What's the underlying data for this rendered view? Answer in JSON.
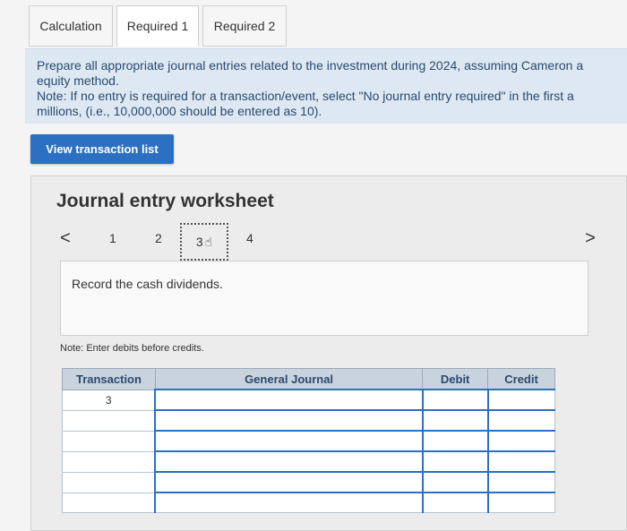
{
  "tabs": [
    {
      "label": "Calculation"
    },
    {
      "label": "Required 1"
    },
    {
      "label": "Required 2"
    }
  ],
  "instructions": {
    "line1": "Prepare all appropriate journal entries related to the investment during 2024, assuming Cameron a",
    "line2": "equity method.",
    "line3": "Note: If no entry is required for a transaction/event, select \"No journal entry required\" in the first a",
    "line4": "millions, (i.e., 10,000,000 should be entered as 10)."
  },
  "view_button": "View transaction list",
  "worksheet": {
    "title": "Journal entry worksheet",
    "nav_prev": "<",
    "nav_next": ">",
    "steps": [
      "1",
      "2",
      "3",
      "4"
    ],
    "prompt": "Record the cash dividends.",
    "note": "Note: Enter debits before credits."
  },
  "table": {
    "headers": {
      "transaction": "Transaction",
      "general_journal": "General Journal",
      "debit": "Debit",
      "credit": "Credit"
    },
    "rows": [
      {
        "transaction": "3",
        "account": "",
        "debit": "",
        "credit": ""
      },
      {
        "transaction": "",
        "account": "",
        "debit": "",
        "credit": ""
      },
      {
        "transaction": "",
        "account": "",
        "debit": "",
        "credit": ""
      },
      {
        "transaction": "",
        "account": "",
        "debit": "",
        "credit": ""
      },
      {
        "transaction": "",
        "account": "",
        "debit": "",
        "credit": ""
      },
      {
        "transaction": "",
        "account": "",
        "debit": "",
        "credit": ""
      }
    ]
  },
  "colors": {
    "accent": "#2b70c2",
    "instruction_bg": "#dde8f3",
    "header_bg": "#c9d3de"
  }
}
